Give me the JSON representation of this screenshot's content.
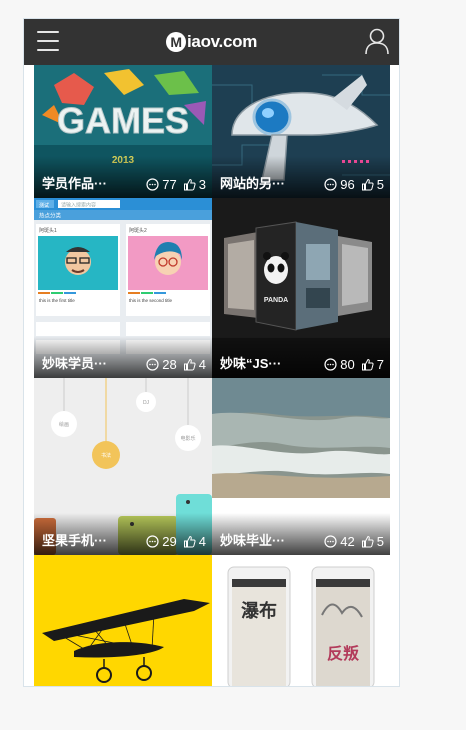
{
  "header": {
    "logo_mark": "M",
    "logo_text": "iaov.com",
    "menu_icon": "hamburger-menu-icon",
    "user_icon": "user-profile-icon"
  },
  "cards": [
    {
      "title": "学员作品···",
      "comments": "77",
      "likes": "3",
      "image_text": "GAMES",
      "image_sub": "2013"
    },
    {
      "title": "网站的另···",
      "comments": "96",
      "likes": "5"
    },
    {
      "title": "妙味学员···",
      "comments": "28",
      "likes": "4",
      "mock_tab": "测试",
      "mock_search": "请输入搜索内容",
      "mock_head": "热点分类",
      "mock_card1": "阿斑头1",
      "mock_card2": "阿斑头2",
      "mock_line1": "this is the first title",
      "mock_line2": "this is the second title"
    },
    {
      "title": "妙味“JS···",
      "comments": "80",
      "likes": "7",
      "image_text": "PANDA"
    },
    {
      "title": "坚果手机···",
      "comments": "29",
      "likes": "4",
      "bubbles": [
        "DJ",
        "绘画",
        "电影乐",
        "书法"
      ]
    },
    {
      "title": "妙味毕业···",
      "comments": "42",
      "likes": "5"
    },
    {
      "title": "",
      "comments": "",
      "likes": ""
    },
    {
      "title": "",
      "comments": "",
      "likes": "",
      "poster1": "瀑布",
      "poster2": "反叛"
    }
  ],
  "colors": {
    "topbar": "#333333",
    "card_yellow": "#ffd700",
    "accent_blue": "#2b8fd6"
  }
}
